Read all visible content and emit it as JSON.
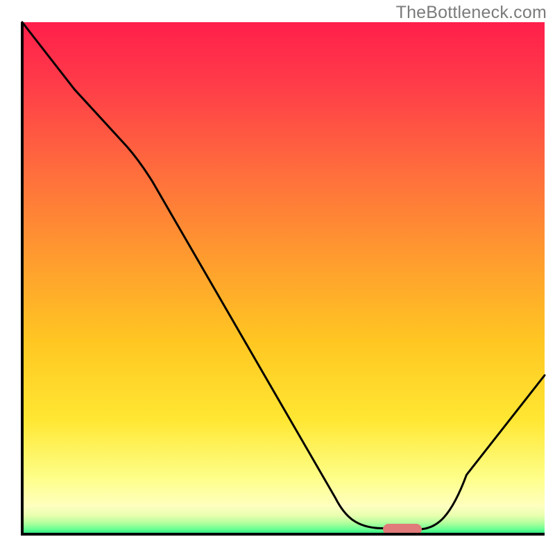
{
  "watermark": "TheBottleneck.com",
  "chart_data": {
    "type": "line",
    "title": "",
    "xlabel": "",
    "ylabel": "",
    "xlim": [
      0,
      1
    ],
    "ylim": [
      0,
      1
    ],
    "note": "Axes carry no visible tick labels in the image; x and y are normalized 0–1 from visual estimation.",
    "series": [
      {
        "name": "bottleneck-curve",
        "x": [
          0.0,
          0.1,
          0.2,
          0.25,
          0.6,
          0.684,
          0.76,
          0.85,
          1.0
        ],
        "y": [
          1.0,
          0.869,
          0.758,
          0.688,
          0.07,
          0.012,
          0.01,
          0.116,
          0.31
        ]
      }
    ],
    "optimal_marker": {
      "x_center": 0.728,
      "y": 0.01
    },
    "background_gradient": {
      "top": "#ff1f4b",
      "mid": "#ffd92a",
      "bottom": "#20e47e"
    }
  }
}
